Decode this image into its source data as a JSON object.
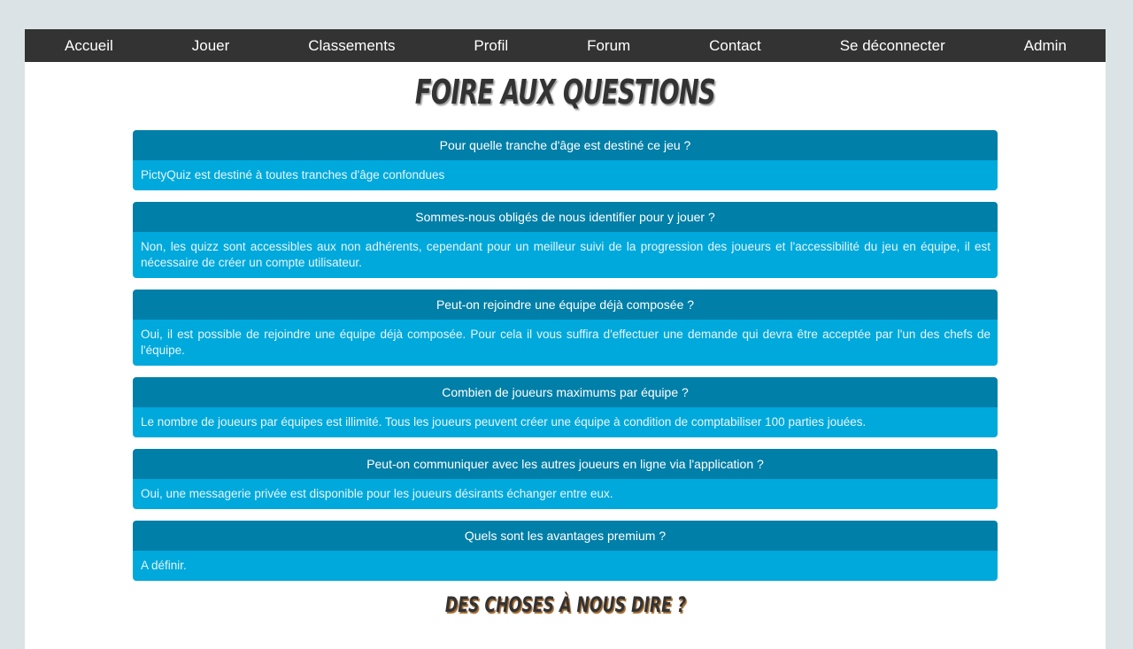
{
  "nav": [
    "Accueil",
    "Jouer",
    "Classements",
    "Profil",
    "Forum",
    "Contact",
    "Se déconnecter",
    "Admin"
  ],
  "title": "FOIRE AUX QUESTIONS",
  "faq": [
    {
      "q": "Pour quelle tranche d'âge est destiné ce jeu ?",
      "a": "PictyQuiz est destiné à toutes tranches d'âge confondues"
    },
    {
      "q": "Sommes-nous obligés de nous identifier pour y jouer ?",
      "a": "Non, les quizz sont accessibles aux non adhérents, cependant pour un meilleur suivi de la progression des joueurs et l'accessibilité du jeu en équipe, il est nécessaire de créer un compte utilisateur."
    },
    {
      "q": "Peut-on rejoindre une équipe déjà composée ?",
      "a": "Oui, il est possible de rejoindre une équipe déjà composée. Pour cela il vous suffira d'effectuer une demande qui devra être acceptée par l'un des chefs de l'équipe."
    },
    {
      "q": "Combien de joueurs maximums par équipe ?",
      "a": "Le nombre de joueurs par équipes est illimité. Tous les joueurs peuvent créer une équipe à condition de comptabiliser 100 parties jouées."
    },
    {
      "q": "Peut-on communiquer avec les autres joueurs en ligne via l'application ?",
      "a": "Oui, une messagerie privée est disponible pour les joueurs désirants échanger entre eux."
    },
    {
      "q": "Quels sont les avantages premium ?",
      "a": "A définir."
    }
  ],
  "subtitle": "DES CHOSES À NOUS DIRE ?",
  "colors": {
    "nav": "#333333",
    "question": "#007fa8",
    "answer": "#00a9dc"
  }
}
